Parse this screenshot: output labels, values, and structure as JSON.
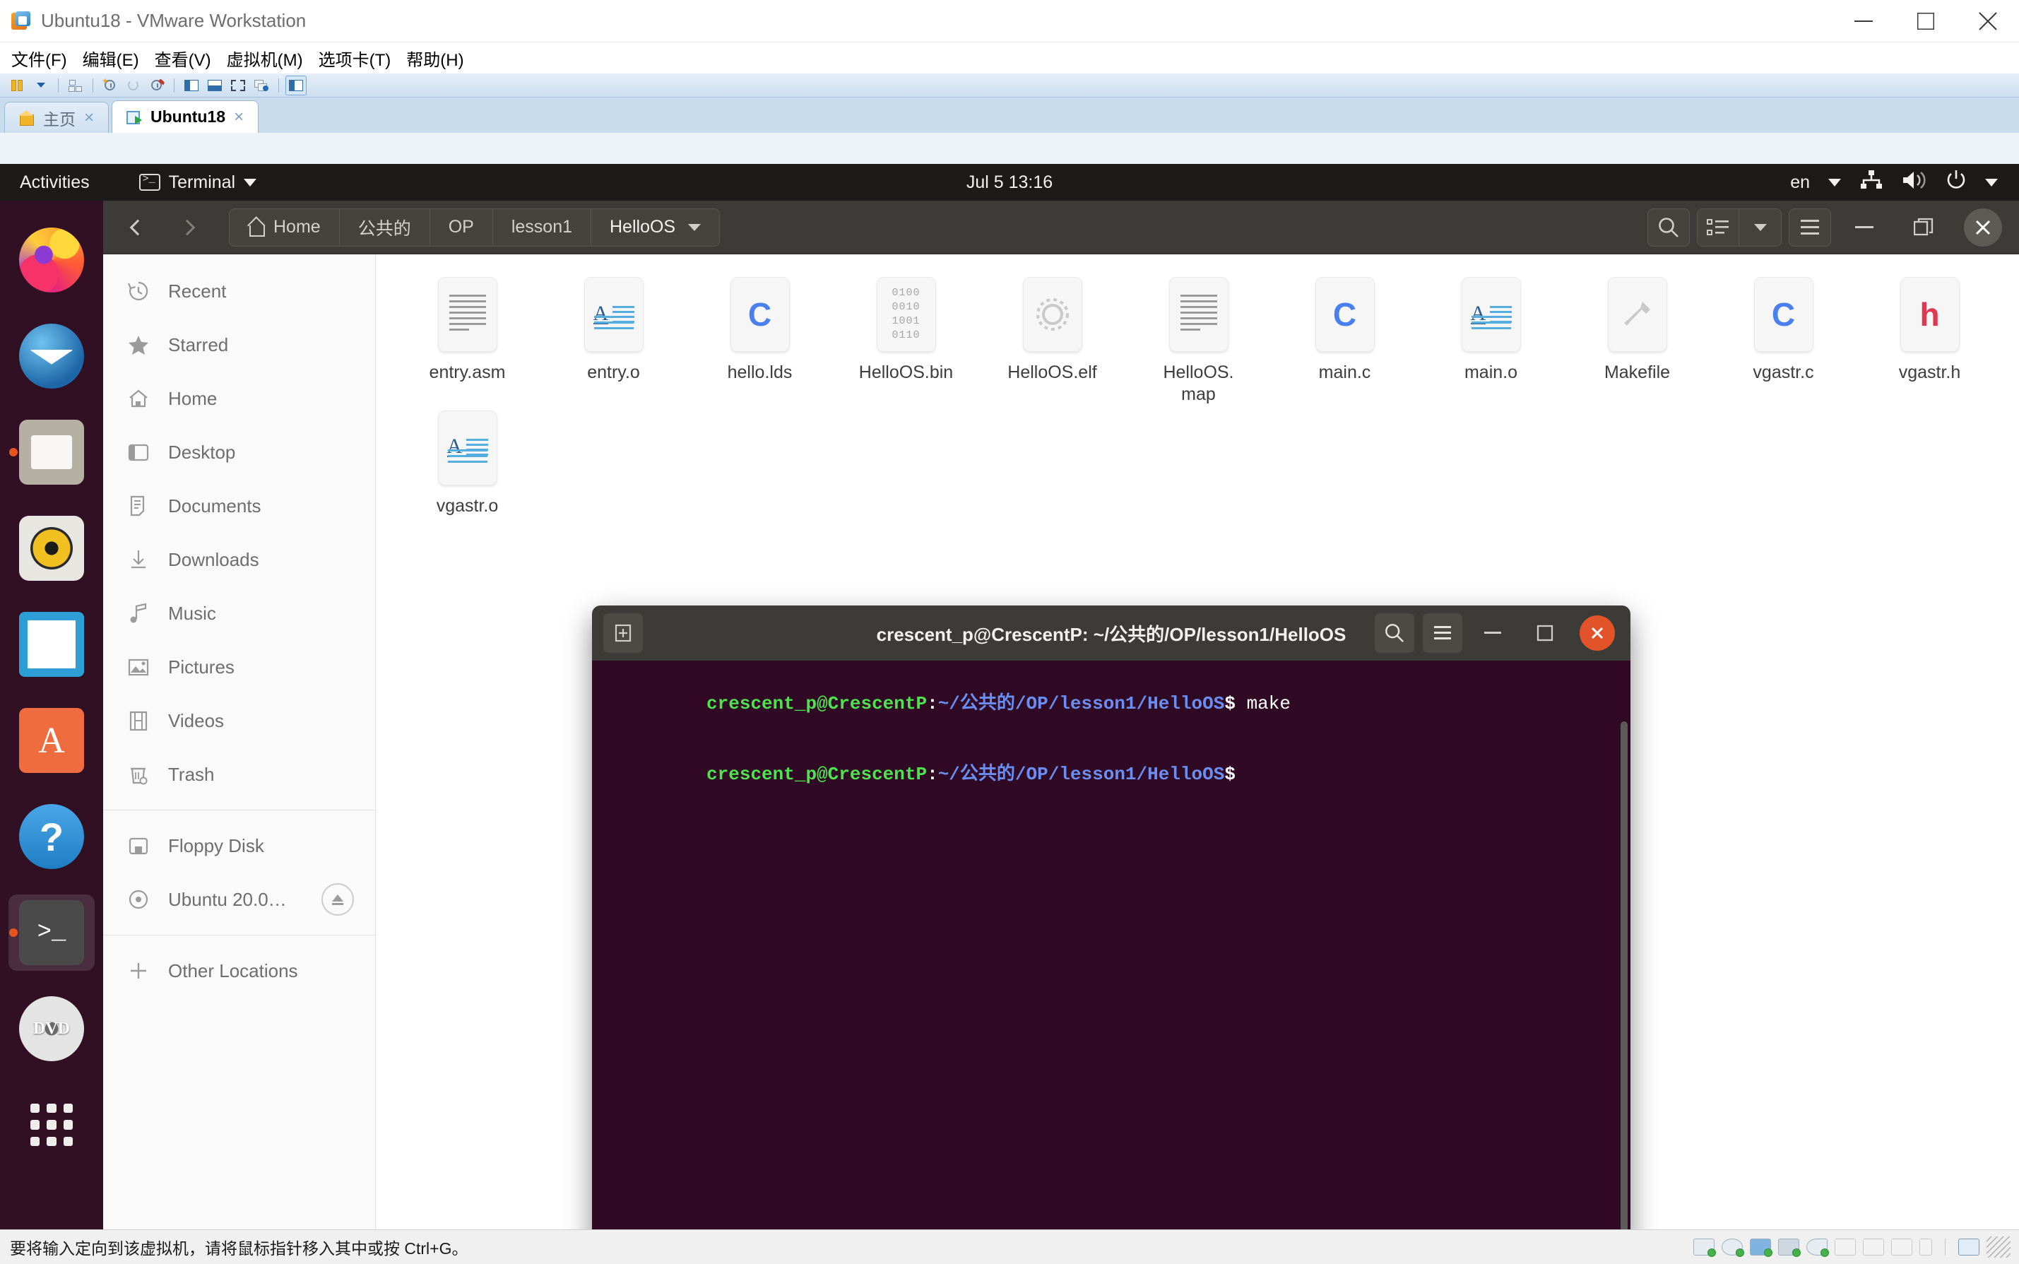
{
  "vmware": {
    "window_title": "Ubuntu18 - VMware Workstation",
    "app_icon": "vmware-logo-icon",
    "window_buttons": [
      {
        "name": "minimize-button",
        "glyph": "minimize-icon"
      },
      {
        "name": "maximize-button",
        "glyph": "maximize-icon"
      },
      {
        "name": "close-button",
        "glyph": "close-icon"
      }
    ],
    "menu": [
      {
        "label": "文件(F)"
      },
      {
        "label": "编辑(E)"
      },
      {
        "label": "查看(V)"
      },
      {
        "label": "虚拟机(M)"
      },
      {
        "label": "选项卡(T)"
      },
      {
        "label": "帮助(H)"
      }
    ],
    "toolbar_icons": [
      "suspend-icon",
      "dropdown-caret-icon",
      "separator",
      "snapshot-manager-icon",
      "separator",
      "take-snapshot-icon",
      "revert-snapshot-icon",
      "manage-snapshots-icon",
      "separator",
      "show-sidebar-icon",
      "show-console-icon",
      "full-screen-icon",
      "unity-mode-icon",
      "separator",
      "show-library-icon"
    ],
    "tabs": [
      {
        "label": "主页",
        "icon": "home-icon",
        "close": "×",
        "active": false
      },
      {
        "label": "Ubuntu18",
        "icon": "virtual-machine-icon",
        "close": "×",
        "active": true
      }
    ],
    "status_bar": {
      "message": "要将输入定向到该虚拟机，请将鼠标指针移入其中或按 Ctrl+G。",
      "device_icons": [
        "hard-disk-icon",
        "cd-dvd-icon",
        "network-adapter-icon",
        "printer-icon",
        "sound-card-icon",
        "camera-icon",
        "display-icon",
        "usb-modem-icon",
        "usb-controller-icon",
        "separator",
        "message-log-icon"
      ]
    }
  },
  "ubuntu": {
    "topbar": {
      "activities": "Activities",
      "app_name": "Terminal",
      "app_icon": "terminal-icon",
      "app_caret": "chevron-down-icon",
      "clock": "Jul 5  13:16",
      "keyboard_layout": "en",
      "tray_icons": [
        "network-icon",
        "volume-icon",
        "power-icon",
        "system-menu-chevron-icon"
      ]
    },
    "dock": [
      {
        "name": "firefox",
        "icon": "firefox-icon",
        "running": false
      },
      {
        "name": "thunderbird",
        "icon": "thunderbird-mail-icon",
        "running": false
      },
      {
        "name": "files",
        "icon": "files-folder-icon",
        "running": true
      },
      {
        "name": "rhythmbox",
        "icon": "rhythmbox-icon",
        "running": false
      },
      {
        "name": "libreoffice-writer",
        "icon": "libreoffice-writer-icon",
        "running": false
      },
      {
        "name": "ubuntu-software",
        "icon": "ubuntu-software-icon",
        "running": false
      },
      {
        "name": "help",
        "icon": "help-question-icon",
        "running": false
      },
      {
        "name": "terminal",
        "icon": "terminal-prompt-icon",
        "running": true,
        "focused": true
      },
      {
        "name": "ubuntu-dvd",
        "icon": "dvd-disc-icon",
        "running": false
      },
      {
        "name": "show-applications",
        "icon": "app-grid-icon",
        "running": false
      }
    ]
  },
  "files_window": {
    "nav": {
      "back_icon": "chevron-left-icon",
      "forward_icon": "chevron-right-icon"
    },
    "breadcrumbs": [
      {
        "label": "Home",
        "icon": "home-icon"
      },
      {
        "label": "公共的"
      },
      {
        "label": "OP"
      },
      {
        "label": "lesson1"
      },
      {
        "label": "HelloOS",
        "current": true,
        "caret": "chevron-down-icon"
      }
    ],
    "header_buttons": [
      {
        "name": "search-button",
        "icon": "search-icon"
      },
      {
        "name": "view-list-button",
        "icon": "list-view-icon"
      },
      {
        "name": "view-options-button",
        "icon": "chevron-down-icon"
      },
      {
        "name": "main-menu-button",
        "icon": "hamburger-menu-icon"
      }
    ],
    "window_buttons": [
      {
        "name": "minimize-button",
        "icon": "minimize-icon"
      },
      {
        "name": "maximize-button",
        "icon": "maximize-icon"
      },
      {
        "name": "close-button",
        "icon": "close-icon"
      }
    ],
    "sidebar": [
      {
        "label": "Recent",
        "icon": "recent-clock-icon"
      },
      {
        "label": "Starred",
        "icon": "star-icon"
      },
      {
        "label": "Home",
        "icon": "home-icon"
      },
      {
        "label": "Desktop",
        "icon": "desktop-icon"
      },
      {
        "label": "Documents",
        "icon": "document-icon"
      },
      {
        "label": "Downloads",
        "icon": "download-arrow-icon"
      },
      {
        "label": "Music",
        "icon": "music-note-icon"
      },
      {
        "label": "Pictures",
        "icon": "picture-icon"
      },
      {
        "label": "Videos",
        "icon": "video-film-icon"
      },
      {
        "label": "Trash",
        "icon": "trash-icon"
      }
    ],
    "sidebar_devices": [
      {
        "label": "Floppy Disk",
        "icon": "floppy-disk-icon"
      },
      {
        "label": "Ubuntu 20.0…",
        "icon": "optical-disc-icon",
        "eject": "eject-icon"
      }
    ],
    "sidebar_other": {
      "label": "Other Locations",
      "icon": "plus-icon"
    },
    "files": [
      {
        "name": "entry.asm",
        "icon": "text-file-icon"
      },
      {
        "name": "entry.o",
        "icon": "document-text-icon"
      },
      {
        "name": "hello.lds",
        "icon": "c-source-icon"
      },
      {
        "name": "HelloOS.bin",
        "icon": "binary-file-icon"
      },
      {
        "name": "HelloOS.elf",
        "icon": "executable-gear-icon"
      },
      {
        "name": "HelloOS.\nmap",
        "icon": "text-file-icon"
      },
      {
        "name": "main.c",
        "icon": "c-source-icon"
      },
      {
        "name": "main.o",
        "icon": "document-text-icon"
      },
      {
        "name": "Makefile",
        "icon": "makefile-hammer-icon"
      },
      {
        "name": "vgastr.c",
        "icon": "c-source-icon"
      },
      {
        "name": "vgastr.h",
        "icon": "h-header-icon"
      },
      {
        "name": "vgastr.o",
        "icon": "document-text-icon"
      }
    ]
  },
  "terminal_window": {
    "title": "crescent_p@CrescentP: ~/公共的/OP/lesson1/HelloOS",
    "new_tab_icon": "new-tab-icon",
    "buttons": [
      {
        "name": "search-button",
        "icon": "search-icon"
      },
      {
        "name": "menu-button",
        "icon": "hamburger-menu-icon"
      }
    ],
    "window_buttons": [
      {
        "name": "minimize-button",
        "icon": "minimize-icon"
      },
      {
        "name": "maximize-button",
        "icon": "maximize-icon"
      },
      {
        "name": "close-button",
        "icon": "close-icon"
      }
    ],
    "lines": [
      {
        "user": "crescent_p@CrescentP",
        "colon": ":",
        "path": "~/公共的/OP/lesson1/HelloOS",
        "dollar": "$",
        "command": " make"
      },
      {
        "user": "crescent_p@CrescentP",
        "colon": ":",
        "path": "~/公共的/OP/lesson1/HelloOS",
        "dollar": "$",
        "command": ""
      }
    ]
  },
  "colors": {
    "ubuntu_purple": "#2c001e",
    "terminal_bg": "#300a24",
    "header_dark": "#3c3b37",
    "accent_orange": "#e8561f",
    "prompt_green": "#4ee24e",
    "prompt_blue": "#6b8ef2",
    "vmware_toolbar_blue": "#cddff1"
  }
}
